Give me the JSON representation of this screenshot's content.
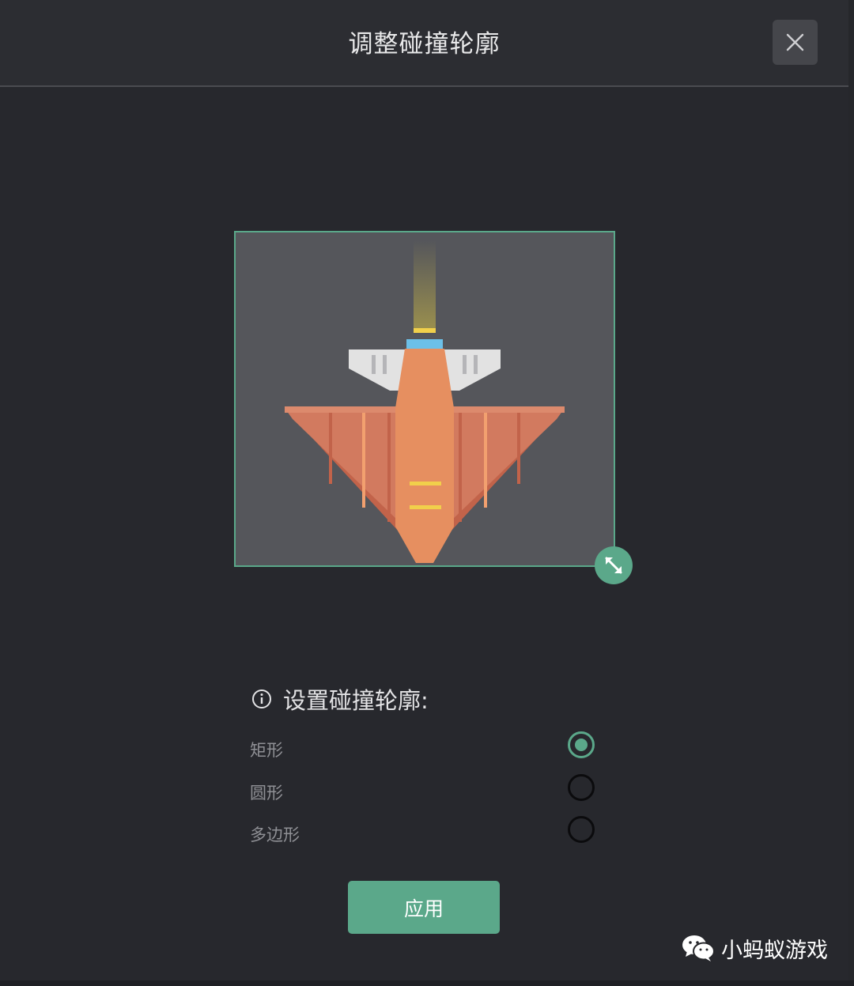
{
  "dialog": {
    "title": "调整碰撞轮廓",
    "close_icon": "close-icon"
  },
  "preview": {
    "sprite": "orange-spaceship",
    "resize_icon": "resize-arrows-icon",
    "accent_color": "#5ba88a"
  },
  "collision": {
    "heading": "设置碰撞轮廓:",
    "info_icon": "info-icon",
    "options": [
      {
        "label": "矩形",
        "selected": true
      },
      {
        "label": "圆形",
        "selected": false
      },
      {
        "label": "多边形",
        "selected": false
      }
    ]
  },
  "actions": {
    "apply_label": "应用"
  },
  "watermark": {
    "icon": "wechat-icon",
    "text": "小蚂蚁游戏"
  }
}
